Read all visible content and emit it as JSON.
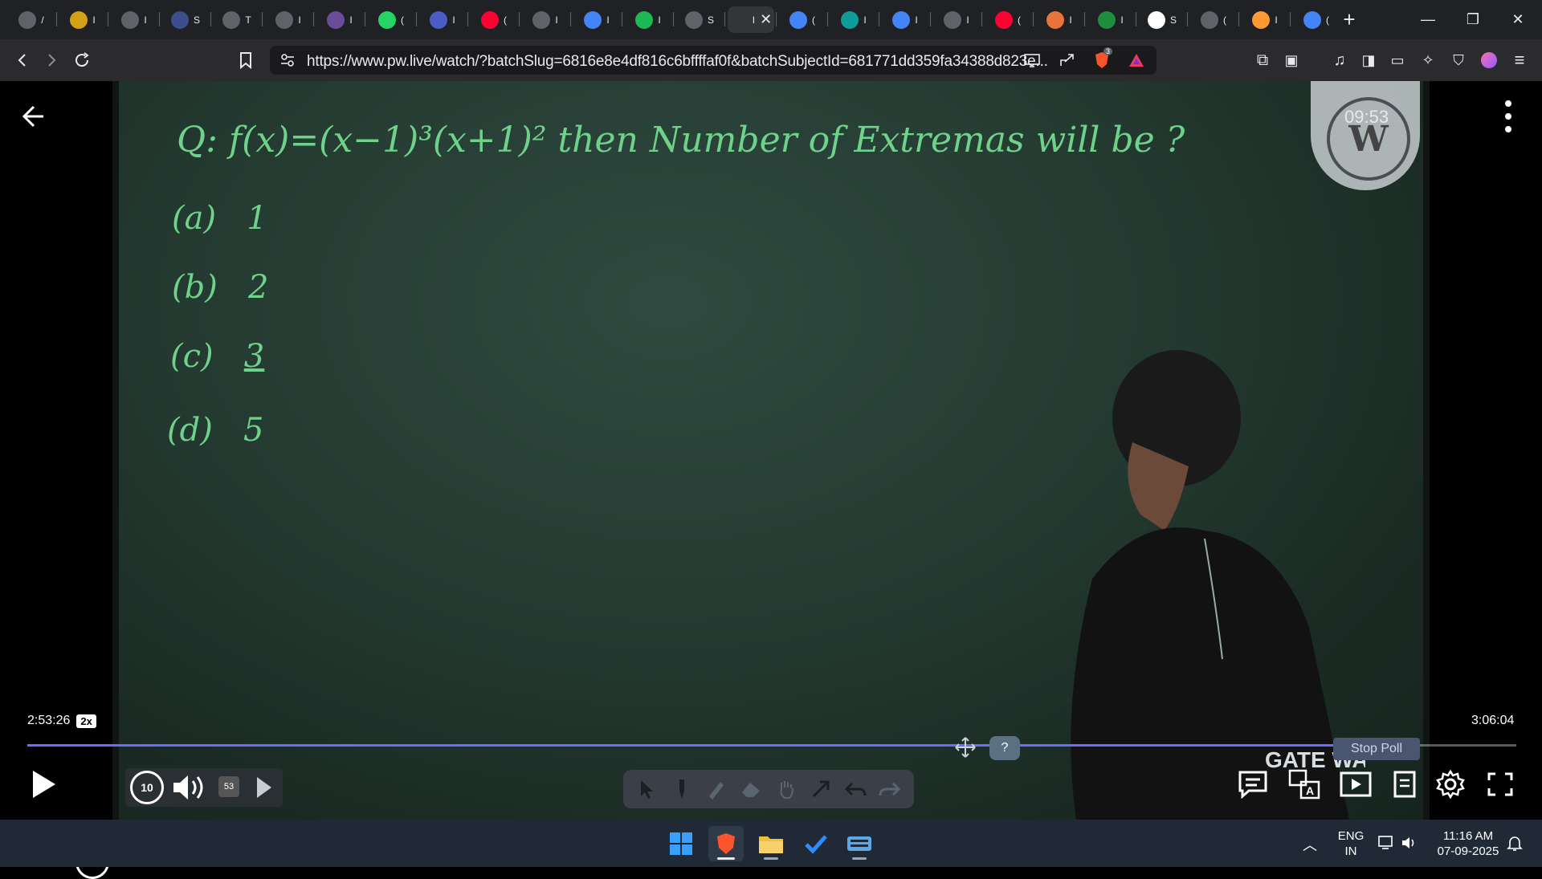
{
  "browser": {
    "tabs": [
      {
        "icon": "copilot-icon",
        "label": "/",
        "color": "#5f6368"
      },
      {
        "icon": "bitcoin-icon",
        "label": "I",
        "color": "#d4a017"
      },
      {
        "icon": "globe-icon",
        "label": "I",
        "color": "#5f6368"
      },
      {
        "icon": "book-icon",
        "label": "S",
        "color": "#3c4f8c"
      },
      {
        "icon": "w3-icon",
        "label": "T",
        "color": "#5f6368"
      },
      {
        "icon": "circle-icon",
        "label": "I",
        "color": "#5f6368"
      },
      {
        "icon": "purple-icon",
        "label": "I",
        "color": "#6b4c9a"
      },
      {
        "icon": "whatsapp-icon",
        "label": "(",
        "color": "#25d366"
      },
      {
        "icon": "bookmark-icon",
        "label": "I",
        "color": "#4b5cc4"
      },
      {
        "icon": "youtube-icon",
        "label": "(",
        "color": "#ff0033"
      },
      {
        "icon": "oracle-icon",
        "label": "I",
        "color": "#5f6368"
      },
      {
        "icon": "google-icon",
        "label": "I",
        "color": "#4285f4"
      },
      {
        "icon": "spotify-icon",
        "label": "I",
        "color": "#1db954"
      },
      {
        "icon": "globe-icon",
        "label": "S",
        "color": "#5f6368"
      },
      {
        "icon": "active-tab-icon",
        "label": "I",
        "color": "#35363a",
        "active": true
      },
      {
        "icon": "gemini-icon",
        "label": "(",
        "color": "#4285f4"
      },
      {
        "icon": "pw-icon",
        "label": "I",
        "color": "#0f9d9a"
      },
      {
        "icon": "google-icon",
        "label": "I",
        "color": "#4285f4"
      },
      {
        "icon": "screen-icon",
        "label": "I",
        "color": "#5f6368"
      },
      {
        "icon": "youtube-icon",
        "label": "(",
        "color": "#ff0033"
      },
      {
        "icon": "burger-icon",
        "label": "I",
        "color": "#e8743b"
      },
      {
        "icon": "chart-icon",
        "label": "I",
        "color": "#1e8e3e"
      },
      {
        "icon": "wiki-icon",
        "label": "S",
        "color": "#ffffff"
      },
      {
        "icon": "globe-icon",
        "label": "(",
        "color": "#5f6368"
      },
      {
        "icon": "flag-icon",
        "label": "I",
        "color": "#ff9933"
      },
      {
        "icon": "gemini-icon",
        "label": "(",
        "color": "#4285f4"
      }
    ],
    "url": "https://www.pw.live/watch/?batchSlug=6816e8e4df816c6bffffaf0f&batchSubjectId=681771dd359fa34388d823e...",
    "shield_count": "3"
  },
  "video": {
    "question": "Q: f(x)=(x−1)³(x+1)²  then Number of Extremas will be ?",
    "options": [
      {
        "label": "a",
        "value": "1"
      },
      {
        "label": "b",
        "value": "2"
      },
      {
        "label": "c",
        "value": "3"
      },
      {
        "label": "d",
        "value": "5"
      }
    ],
    "watermark_time": "09:53",
    "shirt_text": "GATE WALLAH",
    "current_time": "2:53:26",
    "speed": "2x",
    "duration": "3:06:04",
    "progress": 0.9301,
    "stop_poll_label": "Stop Poll",
    "help_label": "?",
    "mini_badge": "53"
  },
  "taskbar": {
    "language": "ENG",
    "region": "IN",
    "time": "11:16 AM",
    "date": "07-09-2025"
  }
}
